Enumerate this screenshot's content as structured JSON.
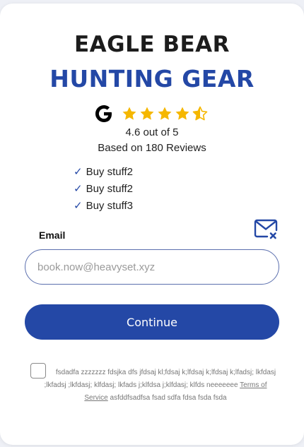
{
  "brand": {
    "line1": "EAGLE BEAR",
    "line2": "HUNTING GEAR"
  },
  "rating": {
    "icon": "google-icon",
    "stars": 4.6,
    "text": "4.6 out of 5",
    "reviews": "Based on 180 Reviews"
  },
  "benefits": [
    {
      "check": "✓",
      "label": "Buy stuff2"
    },
    {
      "check": "✓",
      "label": "Buy stuff2"
    },
    {
      "check": "✓",
      "label": "Buy stuff3"
    }
  ],
  "form": {
    "email_label": "Email",
    "email_placeholder": "book.now@heavyset.xyz",
    "email_value": "",
    "mail_icon": "mail-error-icon",
    "continue_label": "Continue"
  },
  "consent": {
    "text": "fsdadfa zzzzzzz fdsjka dfs jfdsaj kl;fdsaj k;lfdsaj k;lfdsaj k;lfadsj; lkfdasj ;lkfadsj ;lkfdasj; klfdasj; lkfads j;klfdsa j;klfdasj; klfds neeeeeee",
    "link_text": "Terms of Service",
    "suffix": "asfddfsadfsa fsad sdfa fdsa fsda fsda"
  },
  "colors": {
    "brand_blue": "#2448a6",
    "star_gold": "#f5b700"
  }
}
